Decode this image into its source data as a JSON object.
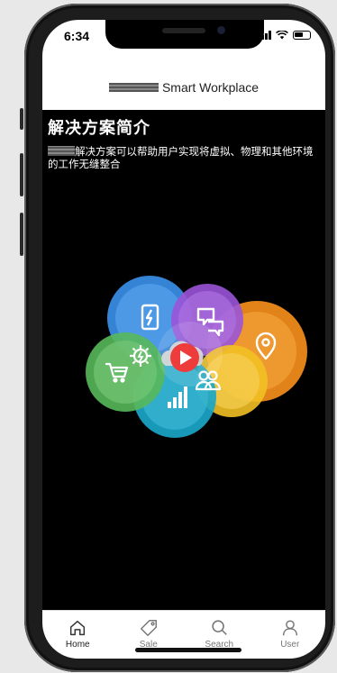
{
  "status": {
    "time": "6:34"
  },
  "header": {
    "title": "Smart Workplace"
  },
  "content": {
    "heading": "解决方案简介",
    "description": "解决方案可以帮助用户实现将虚拟、物理和其他环境的工作无缝整合"
  },
  "graphic": {
    "icons": [
      "mobile-lightning-icon",
      "chat-bubbles-icon",
      "location-pin-icon",
      "cart-icon",
      "gear-icon",
      "play-icon",
      "users-icon",
      "bar-chart-icon"
    ],
    "colors": {
      "blue": "#3a8ee6",
      "purple": "#9a54d8",
      "orange": "#ee8a1a",
      "green": "#58b85a",
      "teal": "#1aa6c8",
      "yellow": "#f2c025",
      "red": "#ee3b3b"
    }
  },
  "tabs": [
    {
      "label": "Home",
      "icon": "home-icon",
      "active": true
    },
    {
      "label": "Sale",
      "icon": "tag-icon",
      "active": false
    },
    {
      "label": "Search",
      "icon": "search-icon",
      "active": false
    },
    {
      "label": "User",
      "icon": "user-icon",
      "active": false
    }
  ]
}
